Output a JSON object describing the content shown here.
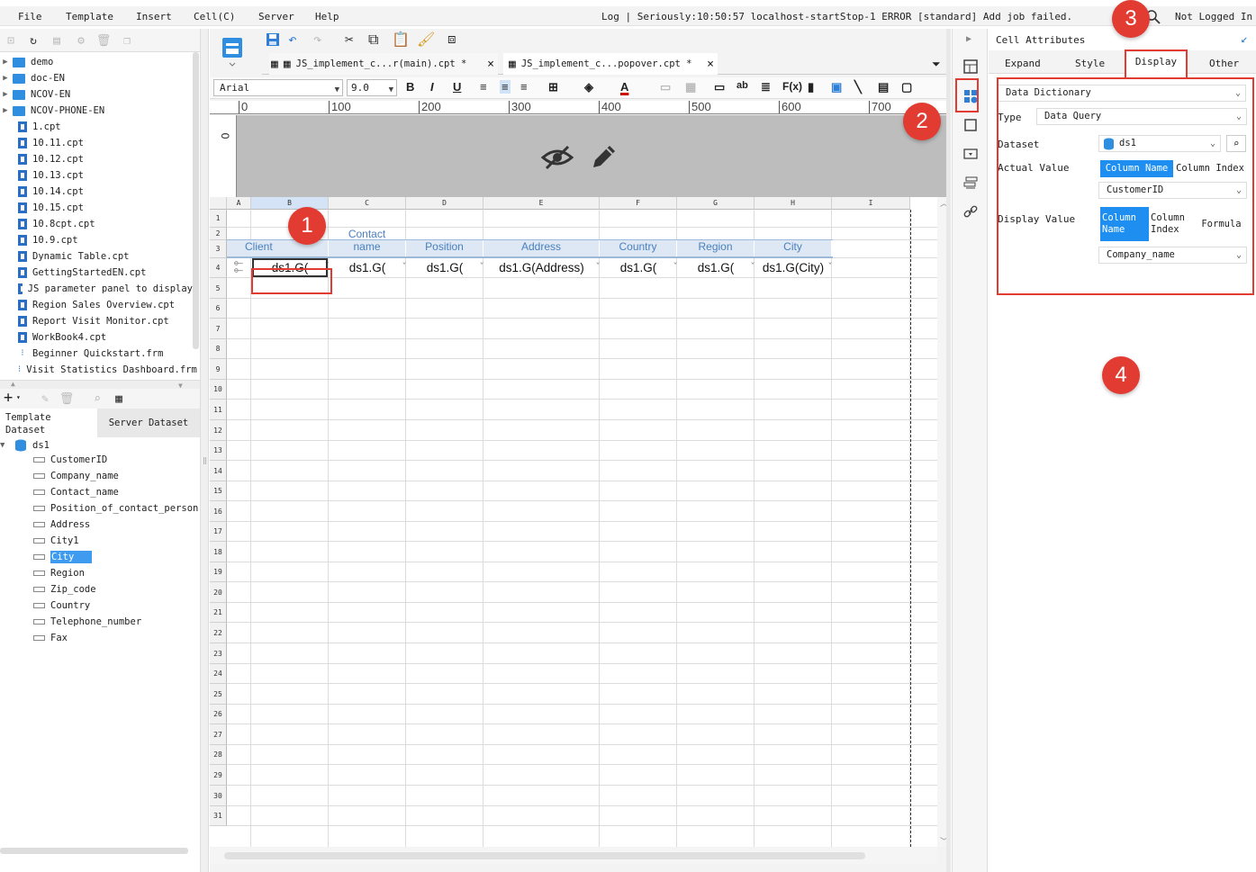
{
  "menu": {
    "items": [
      "File",
      "Template",
      "Insert",
      "Cell(C)",
      "Server",
      "Help"
    ],
    "log": "Log | Seriously:10:50:57 localhost-startStop-1 ERROR [standard] Add job failed.",
    "user": "Not Logged In"
  },
  "tree": {
    "items": [
      {
        "type": "folder",
        "label": "demo"
      },
      {
        "type": "folder",
        "label": "doc-EN"
      },
      {
        "type": "folder",
        "label": "NCOV-EN"
      },
      {
        "type": "folder",
        "label": "NCOV-PHONE-EN"
      },
      {
        "type": "file",
        "label": "1.cpt"
      },
      {
        "type": "file",
        "label": "10.11.cpt"
      },
      {
        "type": "file",
        "label": "10.12.cpt"
      },
      {
        "type": "file",
        "label": "10.13.cpt"
      },
      {
        "type": "file",
        "label": "10.14.cpt"
      },
      {
        "type": "file",
        "label": "10.15.cpt"
      },
      {
        "type": "file",
        "label": "10.8cpt.cpt"
      },
      {
        "type": "file",
        "label": "10.9.cpt"
      },
      {
        "type": "file",
        "label": "Dynamic Table.cpt"
      },
      {
        "type": "file",
        "label": "GettingStartedEN.cpt"
      },
      {
        "type": "file",
        "label": "JS parameter panel to display"
      },
      {
        "type": "file",
        "label": "Region Sales Overview.cpt"
      },
      {
        "type": "file",
        "label": "Report Visit Monitor.cpt"
      },
      {
        "type": "file",
        "label": "WorkBook4.cpt"
      },
      {
        "type": "frm",
        "label": "Beginner Quickstart.frm"
      },
      {
        "type": "frm",
        "label": "Visit Statistics Dashboard.frm"
      }
    ]
  },
  "dataset": {
    "tab_template": "Template Dataset",
    "tab_server": "Server Dataset",
    "name": "ds1",
    "fields": [
      "CustomerID",
      "Company_name",
      "Contact_name",
      "Position_of_contact_person",
      "Address",
      "City1",
      "City",
      "Region",
      "Zip_code",
      "Country",
      "Telephone_number",
      "Fax"
    ],
    "selected": "City"
  },
  "tabs": {
    "tab1": "JS_implement_c...r(main).cpt *",
    "tab2": "JS_implement_c...popover.cpt *"
  },
  "format": {
    "font": "Arial",
    "size": "9.0"
  },
  "ruler": [
    "0",
    "100",
    "200",
    "300",
    "400",
    "500",
    "600",
    "700"
  ],
  "vruler": "0",
  "grid": {
    "columns": [
      "A",
      "B",
      "C",
      "D",
      "E",
      "F",
      "G",
      "H",
      "I"
    ],
    "rows": [
      "1",
      "2",
      "3",
      "4",
      "5",
      "6",
      "7",
      "8",
      "9",
      "10",
      "11",
      "12",
      "13",
      "14",
      "15",
      "16",
      "17",
      "18",
      "19",
      "20",
      "21",
      "22",
      "23",
      "24",
      "25",
      "26",
      "27",
      "28",
      "29",
      "30",
      "31"
    ],
    "headers": [
      "Client",
      "Contact\nname",
      "Position",
      "Address",
      "Country",
      "Region",
      "City"
    ],
    "data": [
      "ds1.G(",
      "ds1.G(",
      "ds1.G(",
      "ds1.G(Address)",
      "ds1.G(",
      "ds1.G(",
      "ds1.G(City)"
    ]
  },
  "panel": {
    "title": "Cell Attributes",
    "tabs": [
      "Expand",
      "Style",
      "Display",
      "Other"
    ],
    "active_tab": "Display",
    "mode": "Data Dictionary",
    "type_label": "Type",
    "type_value": "Data Query",
    "dataset_label": "Dataset",
    "dataset_value": "ds1",
    "actual_label": "Actual Value",
    "actual_seg": [
      "Column Name",
      "Column Index"
    ],
    "actual_value": "CustomerID",
    "display_label": "Display Value",
    "display_seg": [
      "Column\nName",
      "Column\nIndex",
      "Formula"
    ],
    "display_value": "Company_name"
  },
  "badges": [
    "1",
    "2",
    "3",
    "4"
  ],
  "colors": {
    "accent": "#1e8ff0",
    "badge": "#e23b32",
    "header_bg": "#dde8f4",
    "header_text": "#4a7fbd"
  }
}
